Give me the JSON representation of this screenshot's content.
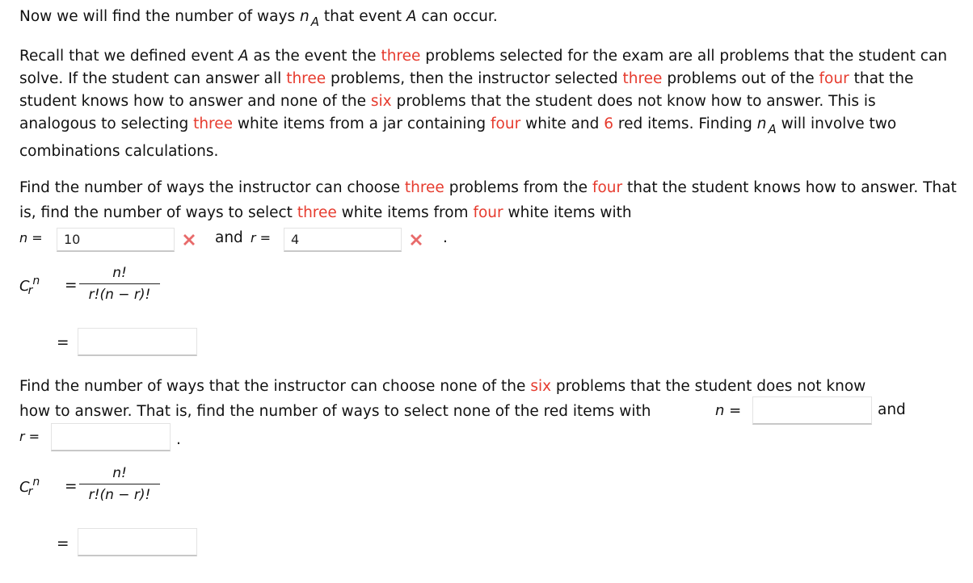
{
  "intro": {
    "text_before": "Now we will find the number of ways ",
    "var_n": "n",
    "var_sub": "A",
    "text_after": " that event ",
    "event": "A",
    "text_end": " can occur."
  },
  "recall": {
    "s1": "Recall that we defined event ",
    "event": "A",
    "s2": " as the event the ",
    "r1": "three",
    "s3": " problems selected for the exam are all problems that the student can solve. If the student can answer all ",
    "r2": "three",
    "s4": " problems, then the instructor selected ",
    "r3": "three",
    "s5": " problems out of the ",
    "r4": "four",
    "s6": " that the student knows how to answer and none of the ",
    "r5": "six",
    "s7": " problems that the student does not know how to answer. This is analogous to selecting ",
    "r6": "three",
    "s8": " white items from a jar containing ",
    "r7": "four",
    "s9": " white and ",
    "r8": "6",
    "s10": " red items. Finding ",
    "var_n": "n",
    "var_sub": "A",
    "s11": " will involve two combinations calculations."
  },
  "part1": {
    "s1": "Find the number of ways the instructor can choose ",
    "r1": "three",
    "s2": " problems from the ",
    "r2": "four",
    "s3": " that the student knows how to answer. That is, find the number of ways to select ",
    "r3": "three",
    "s4": " white items from ",
    "r4": "four",
    "s5": " white items with",
    "n_label": "n =",
    "n_value": "10",
    "and_label": "and",
    "r_label": "r =",
    "r_value": "4",
    "period": ".",
    "n_status": "incorrect",
    "r_status": "incorrect",
    "result_value": ""
  },
  "part2": {
    "s1": "Find the number of ways that the instructor can choose none of the ",
    "r1": "six",
    "s2": " problems that the student does not know how to answer. That is, find the number of ways to select none of the red items with ",
    "n_label": "n =",
    "n_value": "",
    "and_label": "and",
    "r_label": "r =",
    "r_value": "",
    "period": ".",
    "result_value": ""
  },
  "formula": {
    "C": "C",
    "sub": "r",
    "sup": "n",
    "eq": "=",
    "numerator": "n!",
    "denominator": "r!(n − r)!"
  },
  "colors": {
    "highlight": "#e63b2e",
    "error_icon": "#e86a6a"
  }
}
